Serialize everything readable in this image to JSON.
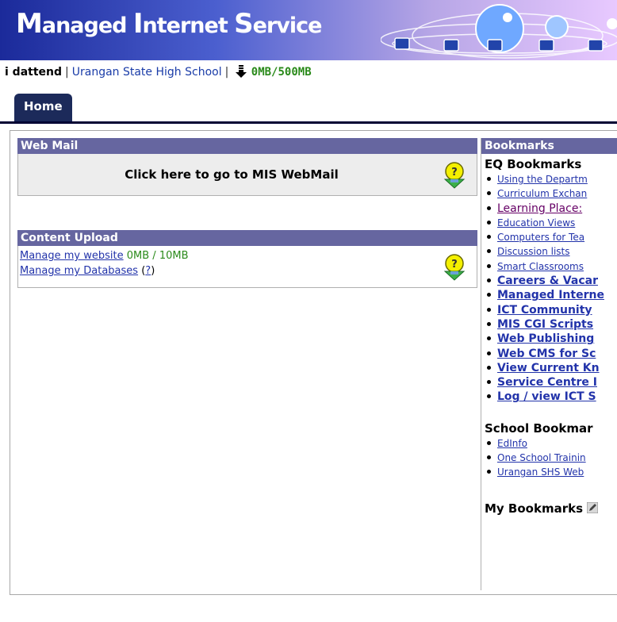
{
  "banner": {
    "title_first_M": "M",
    "title_rest1": "anaged ",
    "title_I": "I",
    "title_rest2": "nternet ",
    "title_S": "S",
    "title_rest3": "ervice"
  },
  "infobar": {
    "user": "i dattend",
    "separator": "|",
    "school": "Urangan State High School",
    "quota": "0MB/500MB"
  },
  "tabs": {
    "home": "Home"
  },
  "webmail": {
    "title": "Web Mail",
    "link": "Click here to go to MIS WebMail"
  },
  "upload": {
    "title": "Content Upload",
    "website_link": "Manage my website",
    "website_quota": "0MB / 10MB",
    "db_link": "Manage my Databases",
    "help_open": "(",
    "help_link": "?",
    "help_close": ")"
  },
  "bookmarks": {
    "title": "Bookmarks",
    "eq_heading": "EQ Bookmarks",
    "eq_items": [
      "Using the Departm",
      "Curriculum Exchan",
      "Learning Place:",
      "Education Views",
      "Computers for Tea",
      "Discussion lists",
      "Smart Classrooms",
      "Careers & Vacar",
      "Managed Interne",
      "ICT Community",
      "MIS CGI Scripts",
      "Web Publishing",
      "Web CMS for Sc",
      "View Current Kn",
      "Service Centre I",
      "Log / view ICT S"
    ],
    "school_heading": "School Bookmar",
    "school_items": [
      "EdInfo",
      "One School Trainin",
      "Urangan SHS Web"
    ],
    "my_heading": "My Bookmarks"
  },
  "colors": {
    "panel_title": "#6666a0",
    "link": "#2233aa",
    "quota_green": "#2a8a1a",
    "tab_bg": "#1c2a5a"
  }
}
